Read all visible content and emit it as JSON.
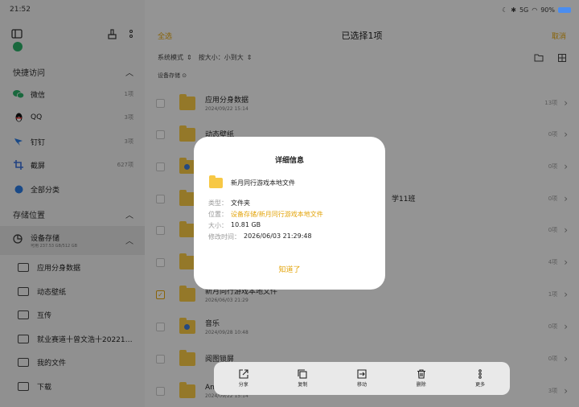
{
  "status": {
    "time": "21:52",
    "battery": "90%",
    "net": "5G"
  },
  "sidebar": {
    "quick_access_title": "快捷访问",
    "quick": [
      {
        "label": "微信",
        "count": "1项",
        "icon": "wechat-icon",
        "color": "#2aae67"
      },
      {
        "label": "QQ",
        "count": "3项",
        "icon": "qq-icon",
        "color": "#111111"
      },
      {
        "label": "钉钉",
        "count": "3项",
        "icon": "dingtalk-icon",
        "color": "#2a7ae2"
      },
      {
        "label": "截屏",
        "count": "627项",
        "icon": "screenshot-icon",
        "color": "#3a6fd8"
      },
      {
        "label": "全部分类",
        "count": "",
        "icon": "categories-icon",
        "color": "#2a7ae2"
      }
    ],
    "storage_title": "存储位置",
    "device": {
      "label": "设备存储",
      "sub": "可用 237.53 GB/512 GB"
    },
    "folders": [
      "应用分身数据",
      "动态壁纸",
      "互传",
      "就业赛道十曾文浩十20221…",
      "我的文件",
      "下载"
    ]
  },
  "main": {
    "select_all": "全选",
    "title": "已选择1项",
    "cancel": "取消",
    "sort_mode": "系统模式",
    "sort_size": "按大小：小到大",
    "crumb": "设备存储",
    "rows": [
      {
        "name": "应用分身数据",
        "date": "2024/09/22 15:14",
        "count": "13项",
        "checked": false
      },
      {
        "name": "动态壁纸",
        "date": "",
        "count": "0项",
        "checked": false
      },
      {
        "name": "",
        "date": "",
        "count": "0项",
        "checked": false
      },
      {
        "name": "学11班",
        "date": "",
        "count": "0项",
        "checked": false
      },
      {
        "name": "",
        "date": "",
        "count": "0项",
        "checked": false
      },
      {
        "name": "",
        "date": "",
        "count": "4项",
        "checked": false
      },
      {
        "name": "新月同行游戏本地文件",
        "date": "2026/06/03 21:29",
        "count": "1项",
        "checked": true
      },
      {
        "name": "音乐",
        "date": "2024/09/28 10:48",
        "count": "0项",
        "checked": false
      },
      {
        "name": "阅图锁屏",
        "date": "",
        "count": "0项",
        "checked": false
      },
      {
        "name": "An",
        "date": "2024/09/22 15:14",
        "count": "3项",
        "checked": false
      }
    ]
  },
  "bottombar": {
    "share": "分享",
    "copy": "复制",
    "move": "移动",
    "delete": "删除",
    "more": "更多"
  },
  "dialog": {
    "title": "详细信息",
    "name": "新月同行游戏本地文件",
    "type_k": "类型：",
    "type_v": "文件夹",
    "loc_k": "位置：",
    "loc_v": "设备存储/新月同行游戏本地文件",
    "size_k": "大小：",
    "size_v": "10.81 GB",
    "time_k": "修改时间：",
    "time_v": "2026/06/03 21:29:48",
    "ok": "知道了"
  }
}
